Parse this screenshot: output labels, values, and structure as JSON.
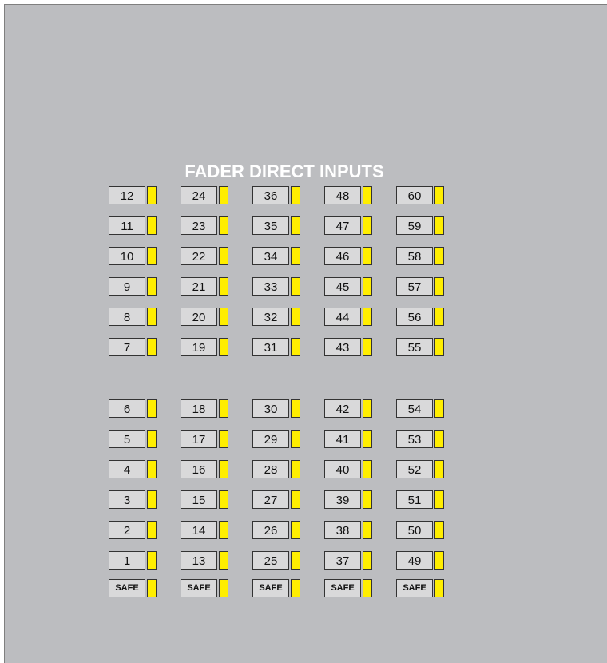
{
  "panel": {
    "title": "FADER DIRECT INPUTS",
    "led_color": "#ffee00",
    "background_color": "#bcbdc0",
    "columns": [
      {
        "upper": [
          "12",
          "11",
          "10",
          "9",
          "8",
          "7"
        ],
        "lower": [
          "6",
          "5",
          "4",
          "3",
          "2",
          "1"
        ],
        "safe_label": "SAFE"
      },
      {
        "upper": [
          "24",
          "23",
          "22",
          "21",
          "20",
          "19"
        ],
        "lower": [
          "18",
          "17",
          "16",
          "15",
          "14",
          "13"
        ],
        "safe_label": "SAFE"
      },
      {
        "upper": [
          "36",
          "35",
          "34",
          "33",
          "32",
          "31"
        ],
        "lower": [
          "30",
          "29",
          "28",
          "27",
          "26",
          "25"
        ],
        "safe_label": "SAFE"
      },
      {
        "upper": [
          "48",
          "47",
          "46",
          "45",
          "44",
          "43"
        ],
        "lower": [
          "42",
          "41",
          "40",
          "39",
          "38",
          "37"
        ],
        "safe_label": "SAFE"
      },
      {
        "upper": [
          "60",
          "59",
          "58",
          "57",
          "56",
          "55"
        ],
        "lower": [
          "54",
          "53",
          "52",
          "51",
          "50",
          "49"
        ],
        "safe_label": "SAFE"
      }
    ]
  }
}
